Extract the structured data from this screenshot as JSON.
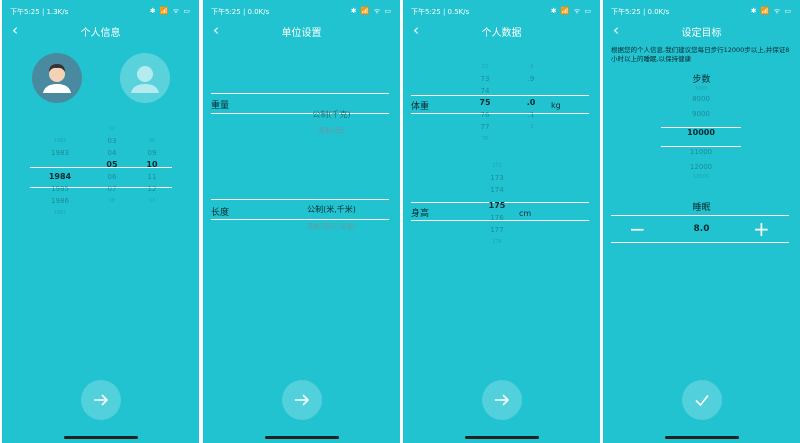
{
  "status": {
    "time1": "下午5:25 | 1.3K/s",
    "time2": "下午5:25 | 0.0K/s",
    "time3": "下午5:25 | 0.5K/s",
    "time4": "下午5:25 | 0.0K/s",
    "icons": "✱ 📶 ᯤ ▭"
  },
  "screen1": {
    "title": "个人信息",
    "years": [
      "1982",
      "1983",
      "1984",
      "1985",
      "1986",
      "1987"
    ],
    "months": [
      "02",
      "03",
      "04",
      "05",
      "06",
      "07",
      "08"
    ],
    "days": [
      "08",
      "09",
      "10",
      "11",
      "12",
      "13"
    ],
    "selected": {
      "year": "1984",
      "month": "05",
      "day": "10"
    }
  },
  "screen2": {
    "title": "单位设置",
    "weight_label": "重量",
    "weight_options": [
      "公制(千克)",
      "英制(磅)"
    ],
    "length_label": "长度",
    "length_options": [
      "公制(米,千米)",
      "英制(英尺,英里)"
    ]
  },
  "screen3": {
    "title": "个人数据",
    "weight_label": "体重",
    "weight_int": [
      "72",
      "73",
      "74",
      "75",
      "76",
      "77",
      "78"
    ],
    "weight_dec": [
      ".8",
      ".9",
      ".0",
      ".1",
      ".2",
      ".3"
    ],
    "weight_unit": "kg",
    "height_label": "身高",
    "height_values": [
      "172",
      "173",
      "174",
      "175",
      "176",
      "177",
      "178"
    ],
    "height_unit": "cm"
  },
  "screen4": {
    "title": "设定目标",
    "desc": "根据您的个人信息,我们建议您每日步行12000步以上,并保证8小时以上的睡眠,以保持健康",
    "steps_label": "步数",
    "steps": [
      "7000",
      "8000",
      "9000",
      "10000",
      "11000",
      "12000",
      "13000"
    ],
    "sleep_label": "睡眠",
    "sleep_value": "8.0",
    "minus": "−",
    "plus": "+"
  }
}
